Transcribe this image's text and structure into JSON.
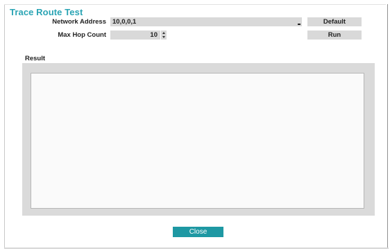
{
  "dialog": {
    "title": "Trace Route Test"
  },
  "form": {
    "network_address": {
      "label": "Network Address",
      "value": "10,0,0,1"
    },
    "max_hop_count": {
      "label": "Max Hop Count",
      "value": "10"
    }
  },
  "buttons": {
    "default_label": "Default",
    "run_label": "Run",
    "close_label": "Close"
  },
  "result": {
    "label": "Result",
    "text": ""
  },
  "colors": {
    "accent": "#2aa4b4",
    "close_button": "#1e98a3",
    "field_bg": "#d9d9d9"
  },
  "icons": {
    "spinner_up": "chevron-up-icon",
    "spinner_down": "chevron-down-icon"
  }
}
